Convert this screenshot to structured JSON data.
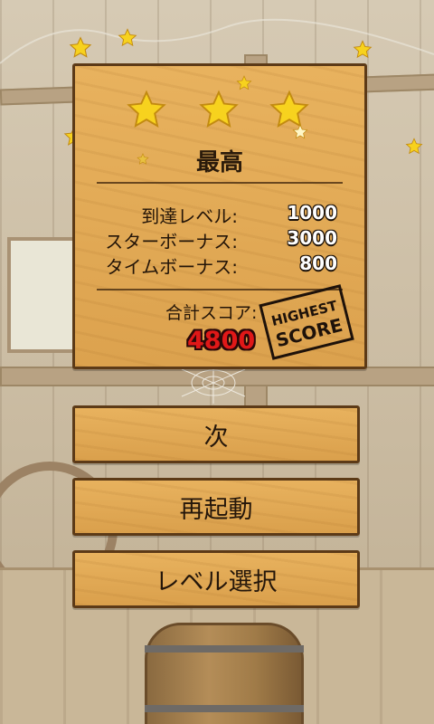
{
  "result": {
    "star_rating": {
      "earned": 3,
      "max": 3
    },
    "title": "最高",
    "rows": [
      {
        "label": "到達レベル:",
        "value": "1000"
      },
      {
        "label": "スターボーナス:",
        "value": "3000"
      },
      {
        "label": "タイムボーナス:",
        "value": "800"
      }
    ],
    "total_label": "合計スコア:",
    "total_value": "4800",
    "stamp": {
      "line1": "HIGHEST",
      "line2": "SCORE"
    }
  },
  "buttons": {
    "next": "次",
    "restart": "再起動",
    "level_select": "レベル選択"
  },
  "colors": {
    "panel": "#dca24e",
    "panel_border": "#5c3a17",
    "star": "#f7d21e",
    "total_score": "#e01818"
  },
  "icons": [
    "star-icon",
    "highest-score-stamp-icon",
    "cobweb-icon"
  ]
}
